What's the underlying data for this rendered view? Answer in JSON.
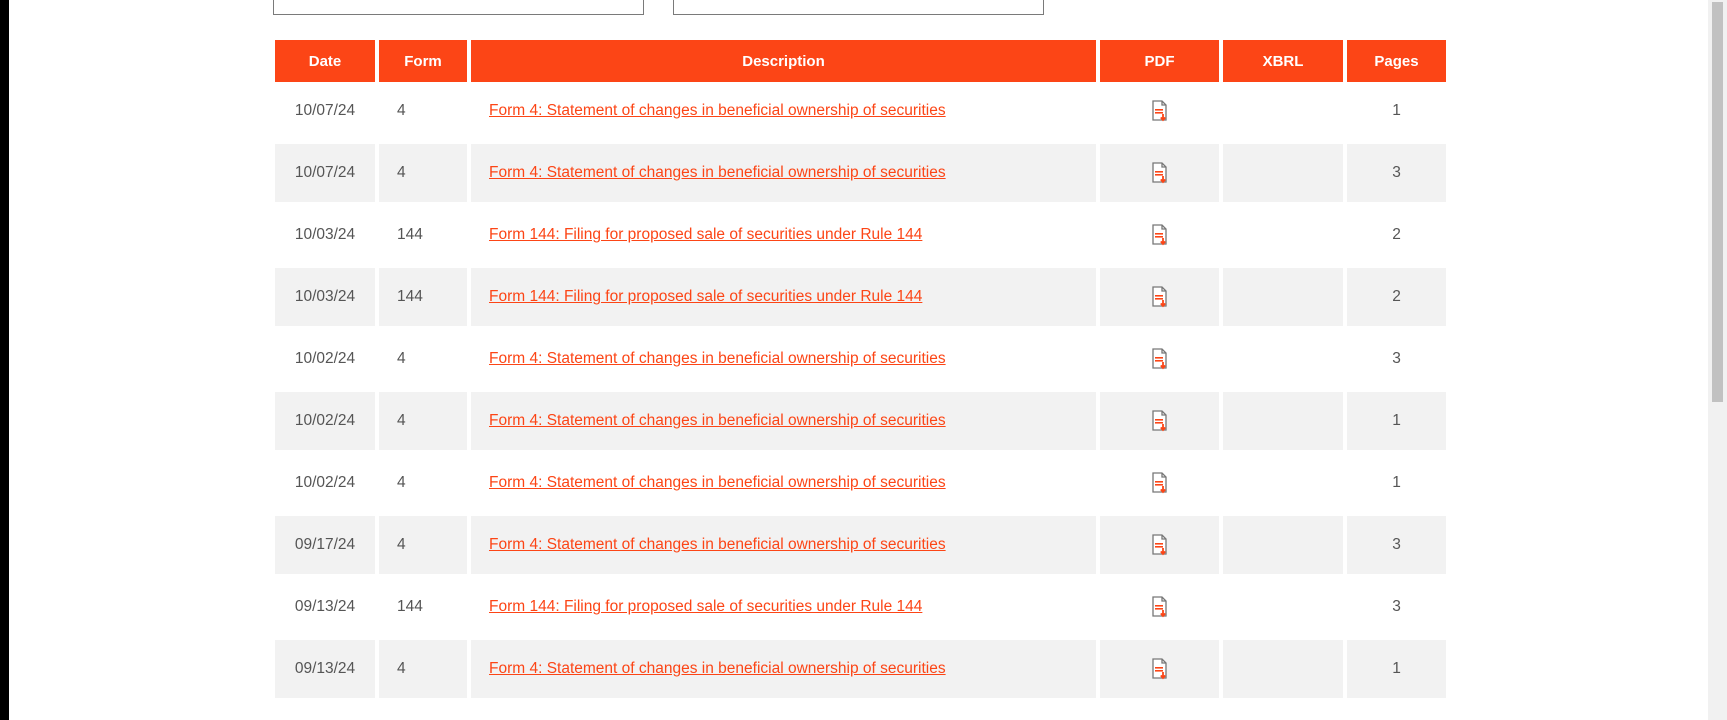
{
  "colors": {
    "accent": "#fc4516",
    "row_shade": "#f2f2f2",
    "text": "#555555"
  },
  "table": {
    "headers": {
      "date": "Date",
      "form": "Form",
      "description": "Description",
      "pdf": "PDF",
      "xbrl": "XBRL",
      "pages": "Pages"
    },
    "rows": [
      {
        "date": "10/07/24",
        "form": "4",
        "description": "Form 4: Statement of changes in beneficial ownership of securities",
        "pdf_icon": "pdf-download-icon",
        "xbrl": "",
        "pages": "1"
      },
      {
        "date": "10/07/24",
        "form": "4",
        "description": "Form 4: Statement of changes in beneficial ownership of securities",
        "pdf_icon": "pdf-download-icon",
        "xbrl": "",
        "pages": "3"
      },
      {
        "date": "10/03/24",
        "form": "144",
        "description": "Form 144: Filing for proposed sale of securities under Rule 144",
        "pdf_icon": "pdf-download-icon",
        "xbrl": "",
        "pages": "2"
      },
      {
        "date": "10/03/24",
        "form": "144",
        "description": "Form 144: Filing for proposed sale of securities under Rule 144",
        "pdf_icon": "pdf-download-icon",
        "xbrl": "",
        "pages": "2"
      },
      {
        "date": "10/02/24",
        "form": "4",
        "description": "Form 4: Statement of changes in beneficial ownership of securities",
        "pdf_icon": "pdf-download-icon",
        "xbrl": "",
        "pages": "3"
      },
      {
        "date": "10/02/24",
        "form": "4",
        "description": "Form 4: Statement of changes in beneficial ownership of securities",
        "pdf_icon": "pdf-download-icon",
        "xbrl": "",
        "pages": "1"
      },
      {
        "date": "10/02/24",
        "form": "4",
        "description": "Form 4: Statement of changes in beneficial ownership of securities",
        "pdf_icon": "pdf-download-icon",
        "xbrl": "",
        "pages": "1"
      },
      {
        "date": "09/17/24",
        "form": "4",
        "description": "Form 4: Statement of changes in beneficial ownership of securities",
        "pdf_icon": "pdf-download-icon",
        "xbrl": "",
        "pages": "3"
      },
      {
        "date": "09/13/24",
        "form": "144",
        "description": "Form 144: Filing for proposed sale of securities under Rule 144",
        "pdf_icon": "pdf-download-icon",
        "xbrl": "",
        "pages": "3"
      },
      {
        "date": "09/13/24",
        "form": "4",
        "description": "Form 4: Statement of changes in beneficial ownership of securities",
        "pdf_icon": "pdf-download-icon",
        "xbrl": "",
        "pages": "1"
      }
    ]
  }
}
